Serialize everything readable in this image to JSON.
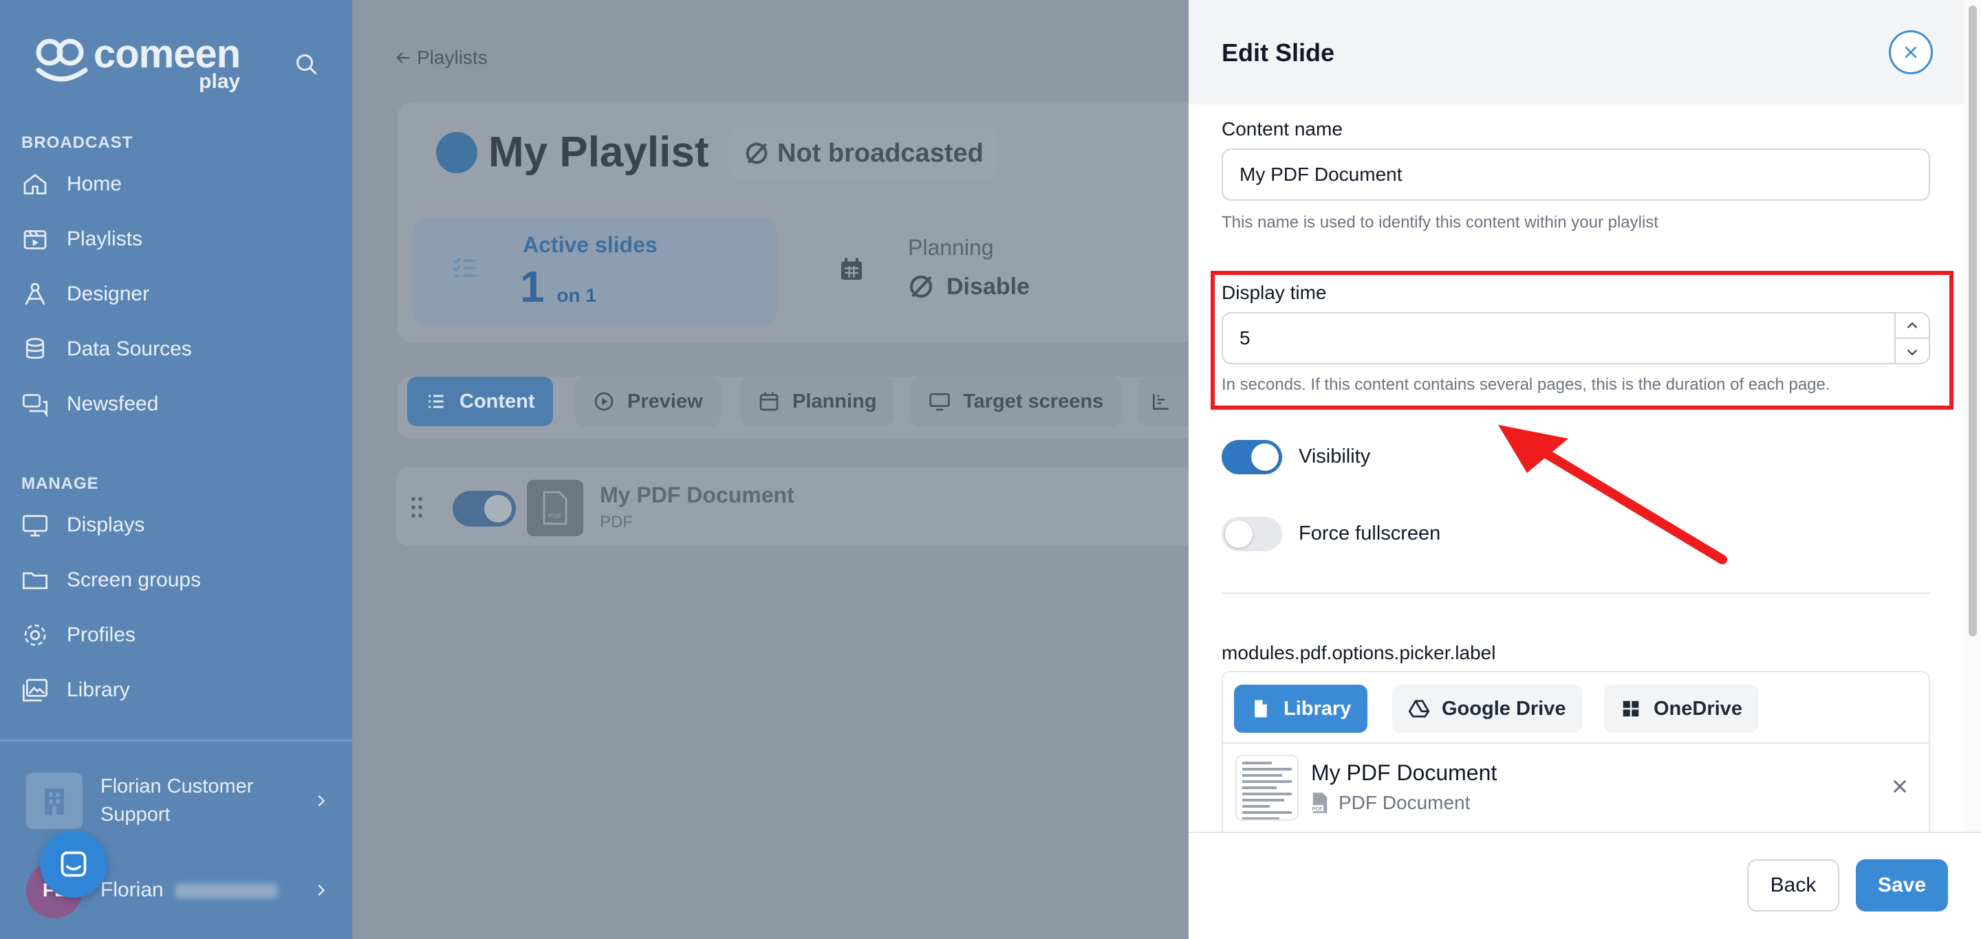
{
  "sidebar": {
    "logo_word": "comeen",
    "logo_sub": "play",
    "sections": {
      "broadcast": "BROADCAST",
      "manage": "MANAGE"
    },
    "broadcast_items": [
      {
        "label": "Home",
        "icon": "home-icon"
      },
      {
        "label": "Playlists",
        "icon": "playlist-icon"
      },
      {
        "label": "Designer",
        "icon": "designer-icon"
      },
      {
        "label": "Data Sources",
        "icon": "database-icon"
      },
      {
        "label": "Newsfeed",
        "icon": "newsfeed-icon"
      }
    ],
    "manage_items": [
      {
        "label": "Displays",
        "icon": "display-icon"
      },
      {
        "label": "Screen groups",
        "icon": "folder-icon"
      },
      {
        "label": "Profiles",
        "icon": "gear-icon"
      },
      {
        "label": "Library",
        "icon": "images-icon"
      }
    ],
    "organization": "Florian Customer Support",
    "user_name": "Florian",
    "avatar_initials": "FL"
  },
  "main": {
    "breadcrumb": "Playlists",
    "playlist_title": "My Playlist",
    "broadcast_status": "Not broadcasted",
    "active_slides": {
      "label": "Active slides",
      "count": "1",
      "suffix": "on 1"
    },
    "planning": {
      "label": "Planning",
      "value": "Disable"
    },
    "tabs": [
      {
        "label": "Content",
        "active": true
      },
      {
        "label": "Preview",
        "active": false
      },
      {
        "label": "Planning",
        "active": false
      },
      {
        "label": "Target screens",
        "active": false
      }
    ],
    "slide_row": {
      "title": "My PDF Document",
      "type": "PDF",
      "enabled": true
    }
  },
  "panel": {
    "title": "Edit Slide",
    "content_name": {
      "label": "Content name",
      "value": "My PDF Document",
      "hint": "This name is used to identify this content within your playlist"
    },
    "display_time": {
      "label": "Display time",
      "value": "5",
      "hint": "In seconds. If this content contains several pages, this is the duration of each page."
    },
    "visibility": {
      "label": "Visibility",
      "on": true
    },
    "force_fullscreen": {
      "label": "Force fullscreen",
      "on": false
    },
    "picker": {
      "label": "modules.pdf.options.picker.label",
      "sources": [
        {
          "label": "Library",
          "active": true,
          "icon": "file-icon"
        },
        {
          "label": "Google Drive",
          "active": false,
          "icon": "google-drive-icon"
        },
        {
          "label": "OneDrive",
          "active": false,
          "icon": "windows-icon"
        }
      ],
      "selected_file": {
        "name": "My PDF Document",
        "type": "PDF Document"
      }
    },
    "back_label": "Back",
    "save_label": "Save"
  },
  "colors": {
    "accent": "#3a8ad6",
    "annotation": "#ee1c1c",
    "sidebar_bg": "#5b86b4"
  }
}
